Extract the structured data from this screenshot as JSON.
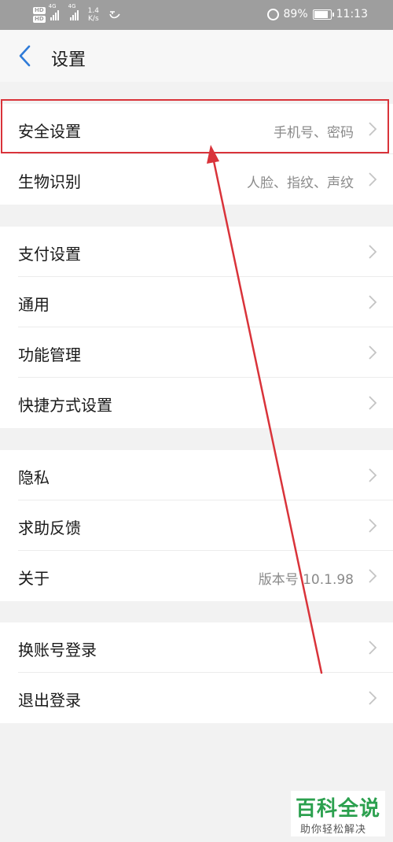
{
  "status_bar": {
    "hd1": "HD",
    "hd2": "HD",
    "net1": "4G",
    "net2": "4G",
    "speed_value": "1.4",
    "speed_unit": "K/s",
    "battery": "89%",
    "time": "11:13"
  },
  "header": {
    "title": "设置"
  },
  "groups": [
    {
      "items": [
        {
          "label": "安全设置",
          "value": "手机号、密码"
        },
        {
          "label": "生物识别",
          "value": "人脸、指纹、声纹"
        }
      ]
    },
    {
      "items": [
        {
          "label": "支付设置",
          "value": ""
        },
        {
          "label": "通用",
          "value": ""
        },
        {
          "label": "功能管理",
          "value": ""
        },
        {
          "label": "快捷方式设置",
          "value": ""
        }
      ]
    },
    {
      "items": [
        {
          "label": "隐私",
          "value": ""
        },
        {
          "label": "求助反馈",
          "value": ""
        },
        {
          "label": "关于",
          "value": "版本号 10.1.98"
        }
      ]
    },
    {
      "items": [
        {
          "label": "换账号登录",
          "value": ""
        },
        {
          "label": "退出登录",
          "value": ""
        }
      ]
    }
  ],
  "watermark": {
    "main": "百科全说",
    "sub": "助你轻松解决"
  },
  "colors": {
    "annotation_red": "#d9333a",
    "back_blue": "#2f7bd8",
    "watermark_green": "#2ba04e"
  }
}
